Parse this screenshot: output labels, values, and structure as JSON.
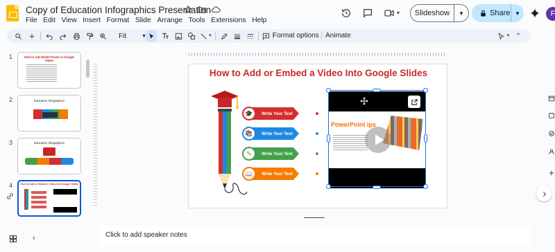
{
  "app": {
    "title": "Copy of Education Infographics Presentation",
    "menu": [
      "File",
      "Edit",
      "View",
      "Insert",
      "Format",
      "Slide",
      "Arrange",
      "Tools",
      "Extensions",
      "Help"
    ],
    "slideshow_label": "Slideshow",
    "share_label": "Share",
    "avatar_initial": "F"
  },
  "toolbar": {
    "zoom": "Fit",
    "format_options": "Format options",
    "animate": "Animate"
  },
  "slides": [
    {
      "number": "1",
      "title": "How to Add Bullet Points in Google Slides"
    },
    {
      "number": "2",
      "title": "Education Infographics"
    },
    {
      "number": "3",
      "title": "Education Infographics"
    },
    {
      "number": "4",
      "title": "How to Add or Embed a Video Into Google Slides",
      "selected": true
    }
  ],
  "current_slide": {
    "title": "How to Add or Embed a Video Into Google Slides",
    "rows": [
      {
        "label": "Write Your Text",
        "color": "#d32f2f"
      },
      {
        "label": "Write Your Text",
        "color": "#1e88e5"
      },
      {
        "label": "Write Your Text",
        "color": "#43a047"
      },
      {
        "label": "Write Your Text",
        "color": "#f57c00"
      }
    ],
    "video_title": "PowerPoint ips"
  },
  "notes": {
    "placeholder": "Click to add speaker notes"
  },
  "colors": {
    "accent": "#0b57d0",
    "share_bg": "#c2e7ff",
    "title_red": "#c62828"
  }
}
